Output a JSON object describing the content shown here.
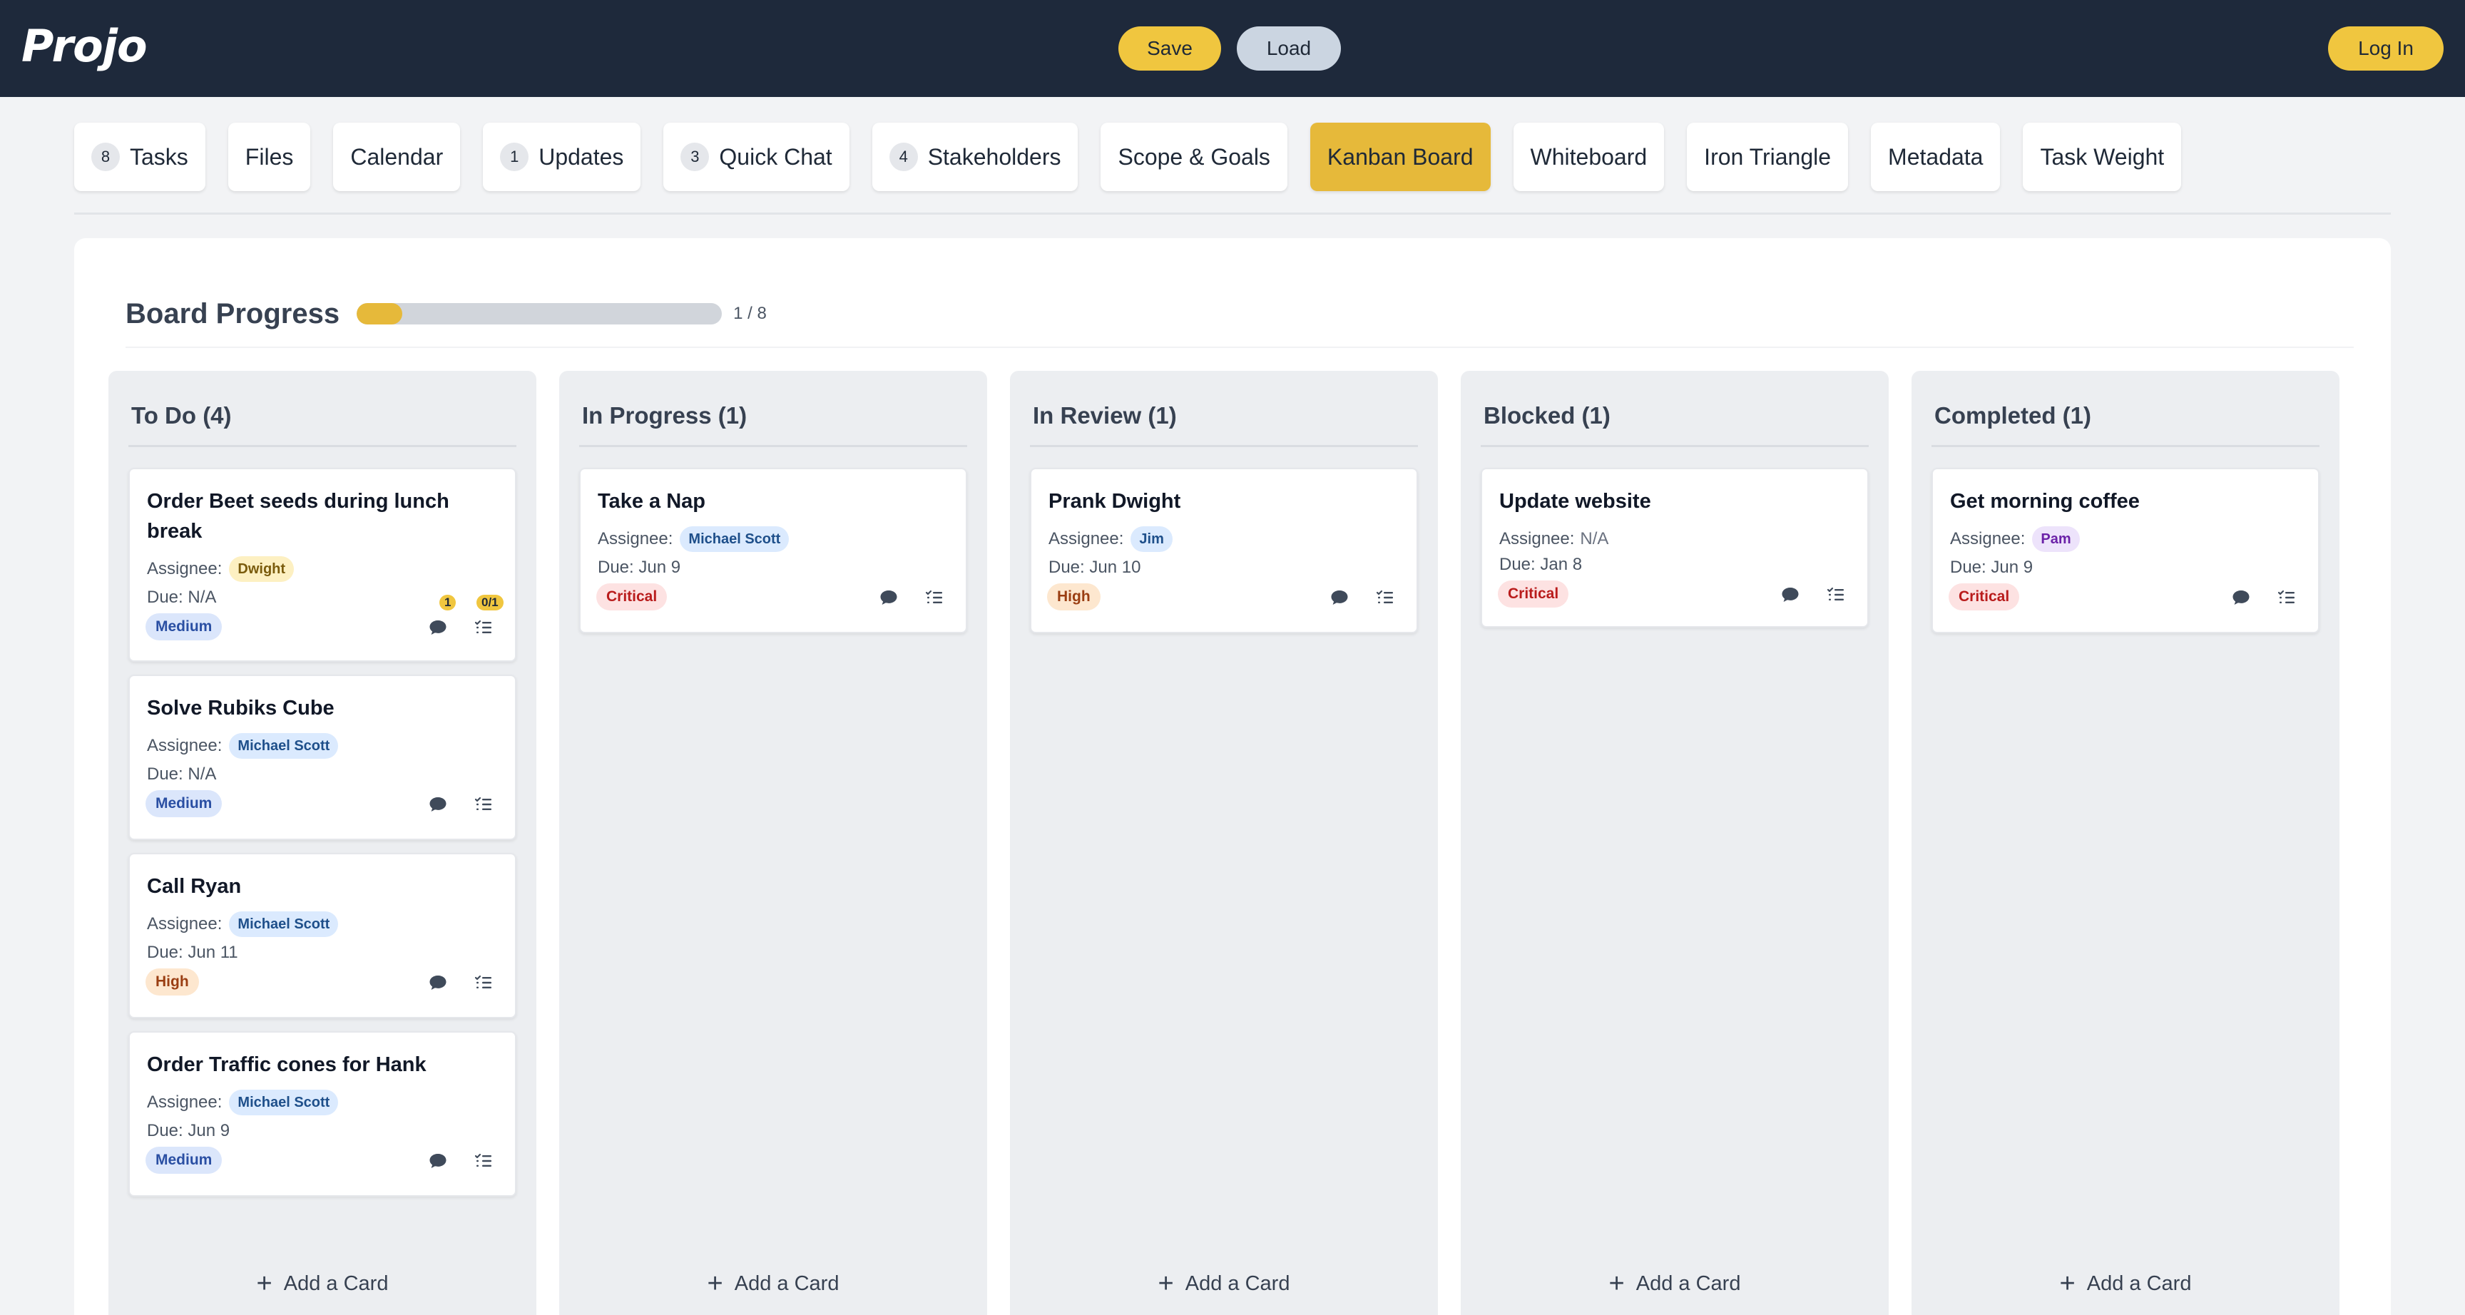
{
  "app": {
    "logo": "Projo",
    "save_label": "Save",
    "load_label": "Load",
    "login_label": "Log In"
  },
  "tabs": [
    {
      "label": "Tasks",
      "badge": "8",
      "active": false
    },
    {
      "label": "Files",
      "badge": "",
      "active": false
    },
    {
      "label": "Calendar",
      "badge": "",
      "active": false
    },
    {
      "label": "Updates",
      "badge": "1",
      "active": false
    },
    {
      "label": "Quick Chat",
      "badge": "3",
      "active": false
    },
    {
      "label": "Stakeholders",
      "badge": "4",
      "active": false
    },
    {
      "label": "Scope & Goals",
      "badge": "",
      "active": false
    },
    {
      "label": "Kanban Board",
      "badge": "",
      "active": true
    },
    {
      "label": "Whiteboard",
      "badge": "",
      "active": false
    },
    {
      "label": "Iron Triangle",
      "badge": "",
      "active": false
    },
    {
      "label": "Metadata",
      "badge": "",
      "active": false
    },
    {
      "label": "Task Weight",
      "badge": "",
      "active": false
    }
  ],
  "board": {
    "progress_title": "Board Progress",
    "progress_count": "1 / 8",
    "progress_fraction": 0.125,
    "assignee_label": "Assignee:",
    "add_card_label": "Add a Card",
    "columns": [
      {
        "title": "To Do (4)",
        "cards": [
          {
            "title": "Order Beet seeds during lunch break",
            "assignee": "Dwight",
            "due": "Due: N/A",
            "priority": "Medium",
            "comment_badge": "1",
            "checklist_badge": "0/1"
          },
          {
            "title": "Solve Rubiks Cube",
            "assignee": "Michael Scott",
            "due": "Due: N/A",
            "priority": "Medium"
          },
          {
            "title": "Call Ryan",
            "assignee": "Michael Scott",
            "due": "Due: Jun 11",
            "priority": "High"
          },
          {
            "title": "Order Traffic cones for Hank",
            "assignee": "Michael Scott",
            "due": "Due: Jun 9",
            "priority": "Medium"
          }
        ]
      },
      {
        "title": "In Progress (1)",
        "cards": [
          {
            "title": "Take a Nap",
            "assignee": "Michael Scott",
            "due": "Due: Jun 9",
            "priority": "Critical"
          }
        ]
      },
      {
        "title": "In Review (1)",
        "cards": [
          {
            "title": "Prank Dwight",
            "assignee": "Jim",
            "due": "Due: Jun 10",
            "priority": "High"
          }
        ]
      },
      {
        "title": "Blocked (1)",
        "cards": [
          {
            "title": "Update website",
            "assignee": "N/A",
            "due": "Due: Jan 8",
            "priority": "Critical"
          }
        ]
      },
      {
        "title": "Completed (1)",
        "cards": [
          {
            "title": "Get morning coffee",
            "assignee": "Pam",
            "due": "Due: Jun 9",
            "priority": "Critical"
          }
        ]
      }
    ]
  },
  "colors": {
    "header_bg": "#1e293b",
    "accent": "#f0c63f",
    "active_tab": "#e6b93a",
    "priority_medium": "#dbe6fb",
    "priority_high": "#fde7cf",
    "priority_critical": "#fde2e2"
  },
  "icons": {
    "comment": "comment-icon",
    "checklist": "checklist-icon",
    "add": "plus-icon"
  }
}
